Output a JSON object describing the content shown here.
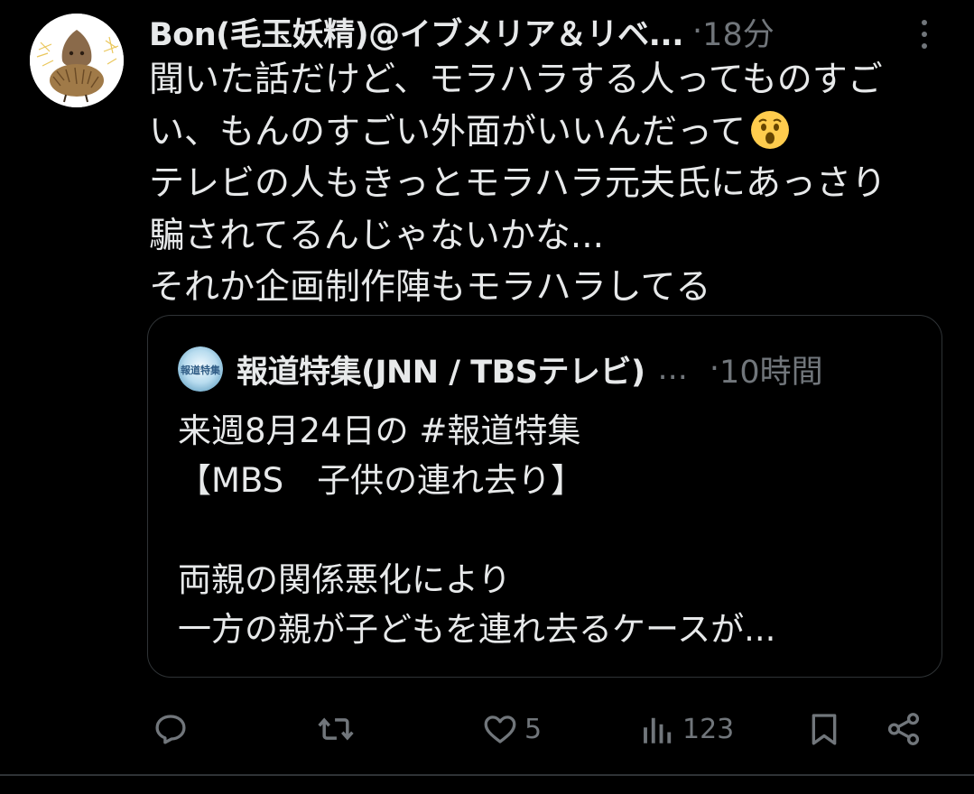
{
  "tweet": {
    "author": "Bon(毛玉妖精)@イブメリア＆リベ...",
    "separator": "·",
    "time": "18分",
    "lines": [
      "聞いた話だけど、モラハラする人ってものすご",
      "い、もんのすごい外面がいいんだって",
      "テレビの人もきっとモラハラ元夫氏にあっさり",
      "騙されてるんじゃないかな...",
      "それか企画制作陣もモラハラしてる"
    ],
    "emoji": "hushed-face-emoji"
  },
  "quote": {
    "author": "報道特集(JNN / TBSテレビ)",
    "ellipsis": "...",
    "separator": "·",
    "time": "10時間",
    "avatar_text": "報道特集",
    "lines": [
      "来週8月24日の #報道特集",
      "【MBS　子供の連れ去り】",
      "",
      "両親の関係悪化により",
      "一方の親が子どもを連れ去るケースが..."
    ]
  },
  "actions": {
    "reply_icon": "reply-icon",
    "retweet_icon": "retweet-icon",
    "like_icon": "heart-icon",
    "like_count": "5",
    "views_icon": "views-icon",
    "views_count": "123",
    "bookmark_icon": "bookmark-icon",
    "share_icon": "share-icon"
  },
  "colors": {
    "background": "#000000",
    "text": "#e7e9ea",
    "muted": "#71767b",
    "border": "#2f3336"
  }
}
